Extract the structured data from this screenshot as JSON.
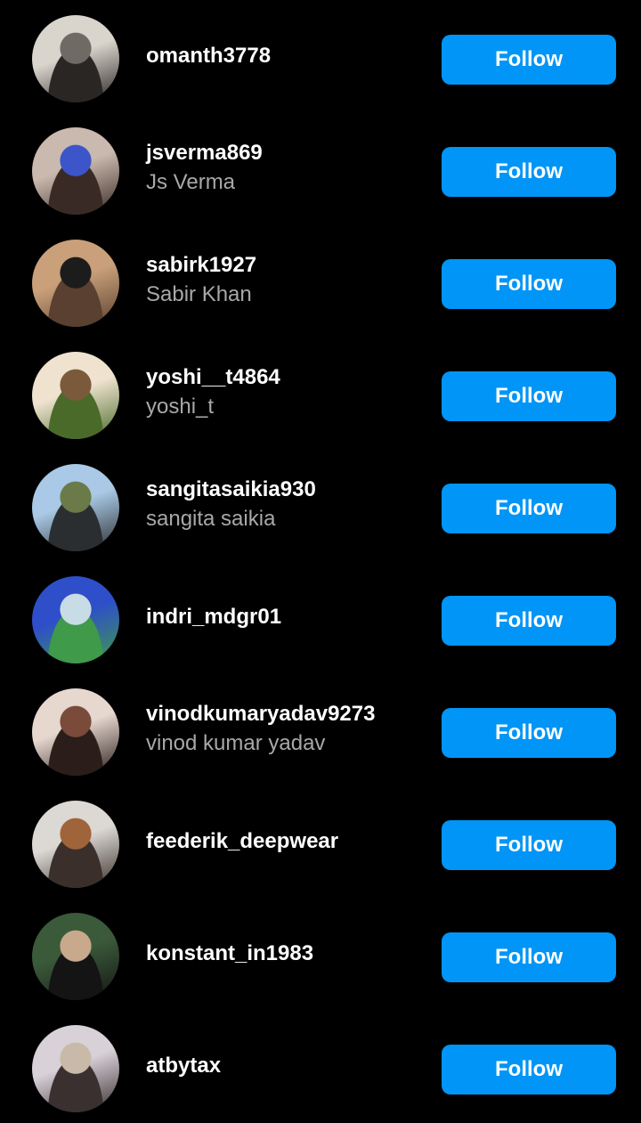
{
  "colors": {
    "background": "#000000",
    "follow_button": "#0095f6",
    "username_text": "#ffffff",
    "fullname_text": "#a8a8a8"
  },
  "users": [
    {
      "username": "omanth3778",
      "fullname": "",
      "button_label": "Follow",
      "avatar_icon": "profile-photo-street",
      "avatar_colors": [
        "#d9d4cc",
        "#6f6a63",
        "#2a2623"
      ]
    },
    {
      "username": "jsverma869",
      "fullname": "Js Verma",
      "button_label": "Follow",
      "avatar_icon": "profile-photo-woman-blue-top",
      "avatar_colors": [
        "#c9b9ae",
        "#3c56c9",
        "#3a2a25"
      ]
    },
    {
      "username": "sabirk1927",
      "fullname": "Sabir Khan",
      "button_label": "Follow",
      "avatar_icon": "profile-photo-man-black-shirt",
      "avatar_colors": [
        "#c9a07a",
        "#1c1c1c",
        "#5a4030"
      ]
    },
    {
      "username": "yoshi__t4864",
      "fullname": "yoshi_t",
      "button_label": "Follow",
      "avatar_icon": "profile-photo-tiki-figurine",
      "avatar_colors": [
        "#efe3d0",
        "#7a5a3a",
        "#4a6a2a"
      ]
    },
    {
      "username": "sangitasaikia930",
      "fullname": "sangita saikia",
      "button_label": "Follow",
      "avatar_icon": "profile-photo-man-outdoors",
      "avatar_colors": [
        "#a9c9e6",
        "#6a7a48",
        "#2b2e30"
      ]
    },
    {
      "username": "indri_mdgr01",
      "fullname": "",
      "button_label": "Follow",
      "avatar_icon": "profile-photo-collage",
      "avatar_colors": [
        "#2e4fc9",
        "#c8dce6",
        "#3f9a4a"
      ]
    },
    {
      "username": "vinodkumaryadav9273",
      "fullname": "vinod kumar yadav",
      "button_label": "Follow",
      "avatar_icon": "profile-photo-woman-eating",
      "avatar_colors": [
        "#e6d7cf",
        "#7a4a3a",
        "#2a1d1a"
      ]
    },
    {
      "username": "feederik_deepwear",
      "fullname": "",
      "button_label": "Follow",
      "avatar_icon": "profile-photo-woman-autumn",
      "avatar_colors": [
        "#dcd9d4",
        "#a0643a",
        "#3a2f2a"
      ]
    },
    {
      "username": "konstant_in1983",
      "fullname": "",
      "button_label": "Follow",
      "avatar_icon": "profile-photo-couple-night",
      "avatar_colors": [
        "#3b5a3a",
        "#c9a98c",
        "#141414"
      ]
    },
    {
      "username": "atbytax",
      "fullname": "",
      "button_label": "Follow",
      "avatar_icon": "profile-photo-light-figure",
      "avatar_colors": [
        "#d8d1d8",
        "#c9b9a9",
        "#3a3030"
      ]
    }
  ]
}
